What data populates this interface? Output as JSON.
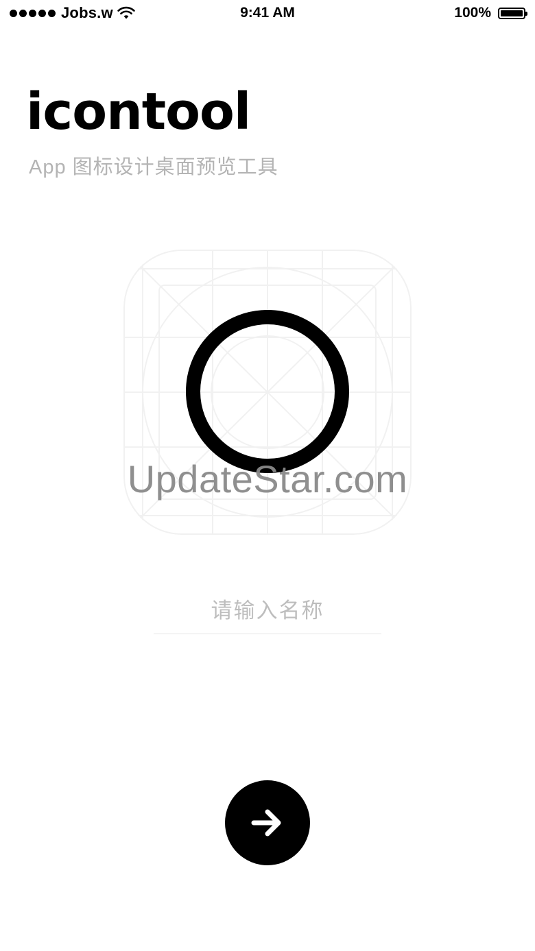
{
  "status_bar": {
    "carrier": "Jobs.w",
    "time": "9:41 AM",
    "battery": "100%"
  },
  "brand": {
    "logo": "icontool",
    "subtitle": "App 图标设计桌面预览工具"
  },
  "preview": {
    "watermark": "UpdateStar.com"
  },
  "form": {
    "name_placeholder": "请输入名称"
  },
  "icons": {
    "signal": "signal-dots-icon",
    "wifi": "wifi-icon",
    "battery": "battery-icon",
    "ring": "circle-ring-icon",
    "grid": "icon-grid-template",
    "next": "arrow-right-icon"
  },
  "colors": {
    "background": "#ffffff",
    "primary": "#000000",
    "subtitle": "#b4b4b4",
    "placeholder": "#bdbdbd",
    "watermark": "#8a8a8a"
  }
}
